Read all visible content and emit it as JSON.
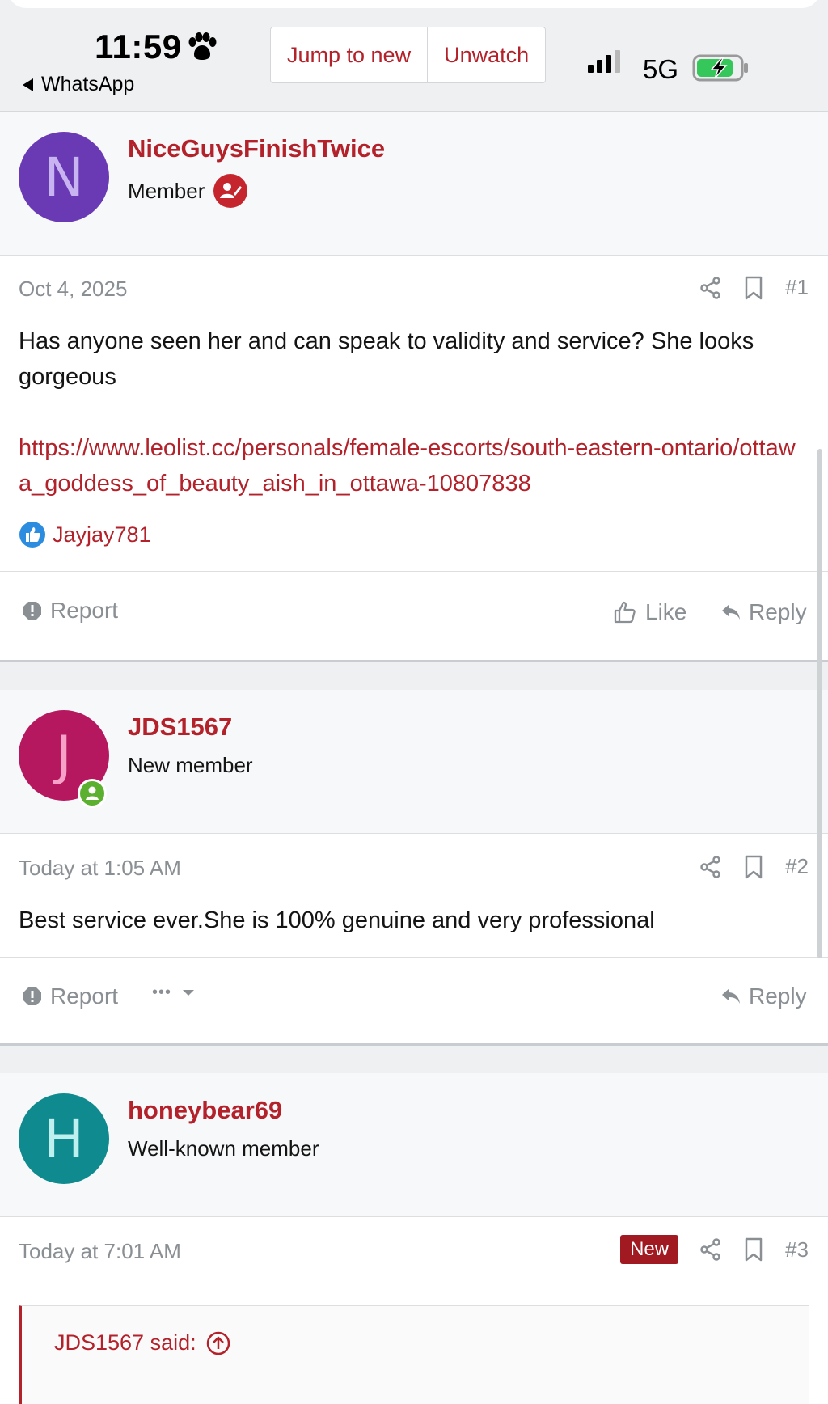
{
  "status_bar": {
    "time": "11:59",
    "back_app": "WhatsApp",
    "network": "5G"
  },
  "thread_actions": {
    "jump_to_new": "Jump to new",
    "unwatch": "Unwatch"
  },
  "colors": {
    "accent": "#b3212a",
    "avatar_n": "#6a3ab5",
    "avatar_j": "#b5185f",
    "avatar_h": "#0f8a8e",
    "new_badge": "#a11a22"
  },
  "posts": [
    {
      "avatar_letter": "N",
      "username": "NiceGuysFinishTwice",
      "user_title": "Member",
      "date": "Oct 4, 2025",
      "number": "#1",
      "body": "Has anyone seen her and can speak to validity and service? She looks gorgeous",
      "link": "https://www.leolist.cc/personals/female-escorts/south-eastern-ontario/ottawa_goddess_of_beauty_aish_in_ottawa-10807838",
      "reaction_user": "Jayjay781",
      "report": "Report",
      "like": "Like",
      "reply": "Reply"
    },
    {
      "avatar_letter": "J",
      "username": "JDS1567",
      "user_title": "New member",
      "date": "Today at 1:05 AM",
      "number": "#2",
      "body": "Best service ever.She is 100% genuine and very professional",
      "report": "Report",
      "more": "•••",
      "reply": "Reply"
    },
    {
      "avatar_letter": "H",
      "username": "honeybear69",
      "user_title": "Well-known member",
      "date": "Today at 7:01 AM",
      "badge": "New",
      "number": "#3",
      "quote_author": "JDS1567 said:"
    }
  ]
}
